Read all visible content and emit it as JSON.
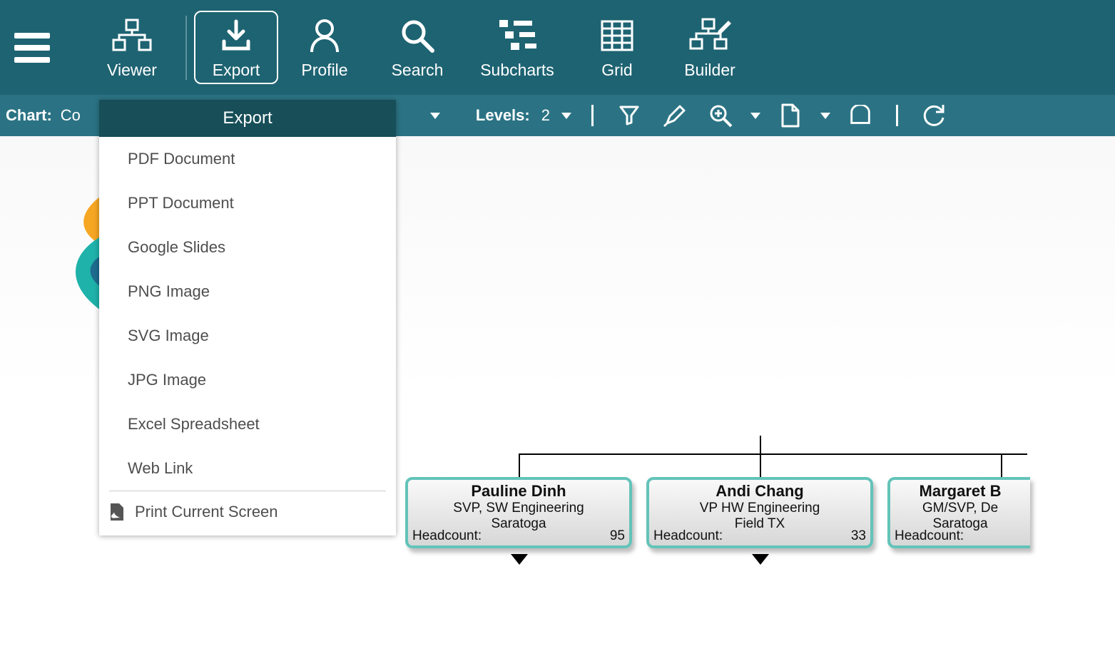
{
  "topbar": {
    "viewer": "Viewer",
    "export": "Export",
    "profile": "Profile",
    "search": "Search",
    "subcharts": "Subcharts",
    "grid": "Grid",
    "builder": "Builder"
  },
  "subbar": {
    "chart_label": "Chart:",
    "chart_name": "Co",
    "levels_label": "Levels:",
    "levels_value": "2"
  },
  "export_menu": {
    "title": "Export",
    "items": [
      "PDF Document",
      "PPT Document",
      "Google Slides",
      "PNG Image",
      "SVG Image",
      "JPG Image",
      "Excel Spreadsheet",
      "Web Link"
    ],
    "print": "Print Current Screen"
  },
  "nodes": [
    {
      "name": "Pauline Dinh",
      "title": "SVP, SW Engineering",
      "location": "Saratoga",
      "hc_label": "Headcount:",
      "hc_value": "95"
    },
    {
      "name": "Andi Chang",
      "title": "VP HW Engineering",
      "location": "Field TX",
      "hc_label": "Headcount:",
      "hc_value": "33"
    },
    {
      "name": "Margaret B",
      "title": "GM/SVP, De",
      "location": "Saratoga",
      "hc_label": "Headcount:",
      "hc_value": ""
    }
  ]
}
